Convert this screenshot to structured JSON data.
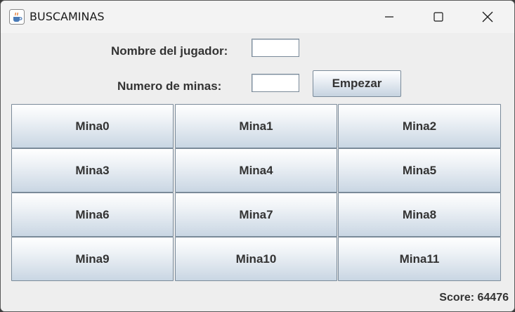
{
  "window": {
    "title": "BUSCAMINAS",
    "icon": "java-cup-icon"
  },
  "form": {
    "player_name_label": "Nombre del jugador:",
    "player_name_value": "",
    "mines_label": "Numero de minas:",
    "mines_value": "",
    "start_label": "Empezar"
  },
  "mines": [
    {
      "label": "Mina0"
    },
    {
      "label": "Mina1"
    },
    {
      "label": "Mina2"
    },
    {
      "label": "Mina3"
    },
    {
      "label": "Mina4"
    },
    {
      "label": "Mina5"
    },
    {
      "label": "Mina6"
    },
    {
      "label": "Mina7"
    },
    {
      "label": "Mina8"
    },
    {
      "label": "Mina9"
    },
    {
      "label": "Mina10"
    },
    {
      "label": "Mina11"
    }
  ],
  "score": {
    "text": "Score: 64476"
  },
  "colors": {
    "background": "#eeeeee",
    "button_border": "#7a8a99",
    "button_gradient_bottom": "#c9d6e3",
    "text": "#333333"
  }
}
